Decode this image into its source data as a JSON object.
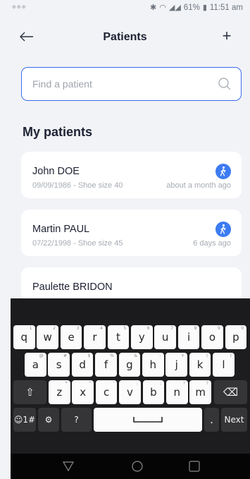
{
  "status": {
    "left": "⊕⊕⊕",
    "battery": "61%",
    "time": "11:51 am"
  },
  "header": {
    "title": "Patients",
    "add_label": "+"
  },
  "search": {
    "placeholder": "Find a patient",
    "value": ""
  },
  "section_title": "My patients",
  "patients": [
    {
      "name": "John DOE",
      "meta": "09/09/1986 - Shoe size 40",
      "time": "about a month ago",
      "badge": true
    },
    {
      "name": "Martin PAUL",
      "meta": "07/22/1998 - Shoe size 45",
      "time": "6 days ago",
      "badge": true
    },
    {
      "name": "Paulette BRIDON",
      "meta": "",
      "time": "",
      "badge": false
    }
  ],
  "keyboard": {
    "row1": [
      {
        "k": "q",
        "h": "1"
      },
      {
        "k": "w",
        "h": "2"
      },
      {
        "k": "e",
        "h": "3"
      },
      {
        "k": "r",
        "h": "4"
      },
      {
        "k": "t",
        "h": "5"
      },
      {
        "k": "y",
        "h": "6"
      },
      {
        "k": "u",
        "h": "7"
      },
      {
        "k": "i",
        "h": "8"
      },
      {
        "k": "o",
        "h": "9"
      },
      {
        "k": "p",
        "h": "0"
      }
    ],
    "row2": [
      {
        "k": "a",
        "h": "@"
      },
      {
        "k": "s",
        "h": "#"
      },
      {
        "k": "d",
        "h": "$"
      },
      {
        "k": "f",
        "h": "%"
      },
      {
        "k": "g",
        "h": "&"
      },
      {
        "k": "h",
        "h": "-"
      },
      {
        "k": "j",
        "h": "+"
      },
      {
        "k": "k",
        "h": "("
      },
      {
        "k": "l",
        "h": ")"
      }
    ],
    "row3": [
      {
        "k": "z",
        "h": "*"
      },
      {
        "k": "x",
        "h": "\""
      },
      {
        "k": "c",
        "h": "'"
      },
      {
        "k": "v",
        "h": ":"
      },
      {
        "k": "b",
        "h": ";"
      },
      {
        "k": "n",
        "h": "!"
      },
      {
        "k": "m",
        "h": "?"
      }
    ],
    "shift": "⇧",
    "backspace": "⌫",
    "emoji_num": "☺1#",
    "settings": "⚙",
    "question": "?",
    "period": ".",
    "next": "Next",
    "space": "⎵"
  },
  "colors": {
    "accent": "#3c6df0",
    "badge": "#3c7bf2",
    "background": "#f1f3f6"
  }
}
